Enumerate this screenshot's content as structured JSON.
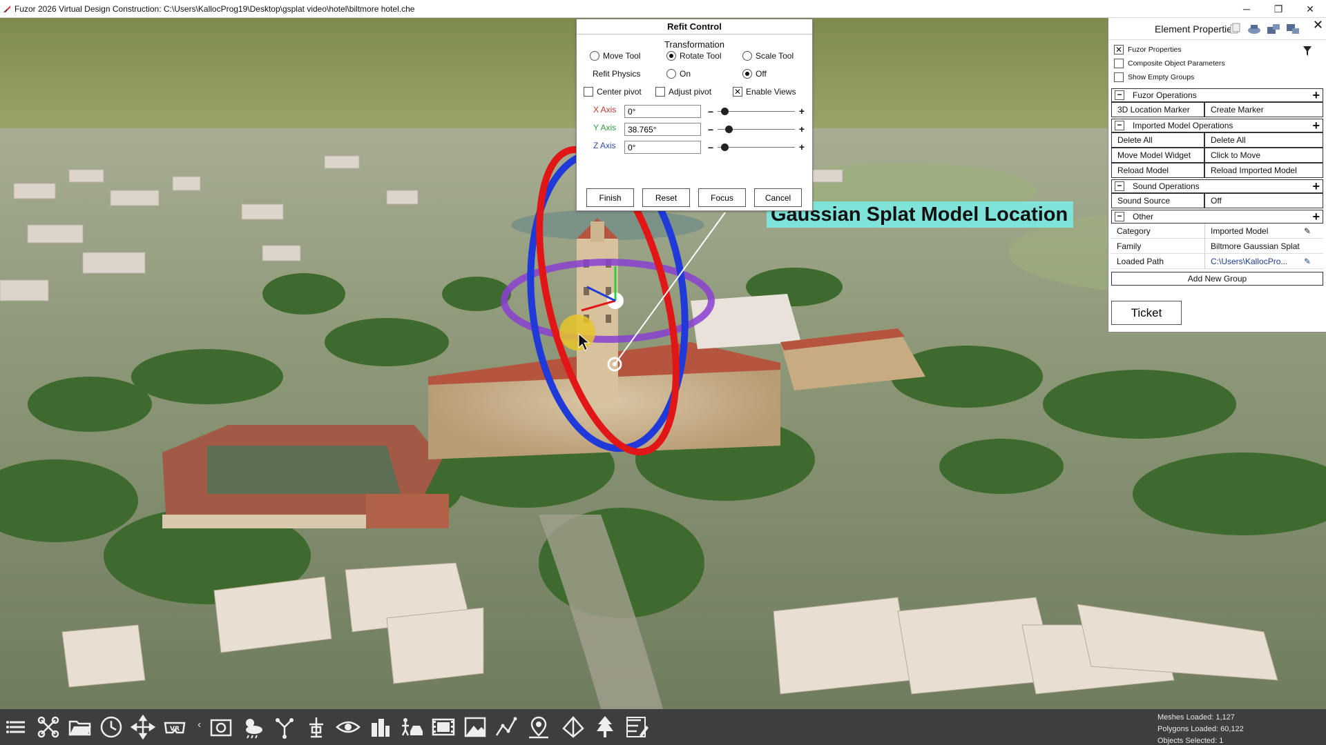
{
  "window": {
    "title": "Fuzor 2026 Virtual Design Construction: C:\\Users\\KallocProg19\\Desktop\\gsplat video\\hotel\\biltmore hotel.che",
    "minimize": "─",
    "restore": "❐",
    "close": "✕"
  },
  "refit": {
    "title": "Refit Control",
    "section": "Transformation",
    "tools": [
      "Move Tool",
      "Rotate Tool",
      "Scale Tool"
    ],
    "selected_tool": "Rotate Tool",
    "physics_label": "Refit Physics",
    "physics_on": "On",
    "physics_off": "Off",
    "physics_value": "Off",
    "center_pivot": "Center pivot",
    "adjust_pivot": "Adjust pivot",
    "enable_views": "Enable Views",
    "center_pivot_checked": false,
    "adjust_pivot_checked": false,
    "enable_views_checked": true,
    "axes": [
      {
        "label": "X Axis",
        "value": "0°",
        "color": "#c0392b",
        "slider": 0.05
      },
      {
        "label": "Y Axis",
        "value": "38.765°",
        "color": "#2e9e3a",
        "slider": 0.11
      },
      {
        "label": "Z Axis",
        "value": "0°",
        "color": "#2b4fa8",
        "slider": 0.05
      }
    ],
    "slider_minus": "−",
    "slider_plus": "+",
    "buttons": [
      "Finish",
      "Reset",
      "Focus",
      "Cancel"
    ]
  },
  "annotation": "Gaussian Splat Model Location",
  "props": {
    "title": "Element Properties",
    "close": "✕",
    "checks": [
      {
        "label": "Fuzor Properties",
        "checked": true
      },
      {
        "label": "Composite Object Parameters",
        "checked": false
      },
      {
        "label": "Show Empty Groups",
        "checked": false
      }
    ],
    "groups": {
      "fuzor_ops": "Fuzor Operations",
      "imported_ops": "Imported Model Operations",
      "sound_ops": "Sound Operations",
      "other": "Other"
    },
    "fuzor_rows": [
      {
        "k": "3D Location Marker",
        "v": "Create Marker"
      }
    ],
    "imported_rows": [
      {
        "k": "Delete All",
        "v": "Delete All"
      },
      {
        "k": "Move Model Widget",
        "v": "Click to Move"
      },
      {
        "k": "Reload Model",
        "v": "Reload Imported Model"
      }
    ],
    "sound_rows": [
      {
        "k": "Sound Source",
        "v": "Off"
      }
    ],
    "other_rows": [
      {
        "k": "Category",
        "v": "Imported Model"
      },
      {
        "k": "Family",
        "v": "Biltmore Gaussian Splat"
      },
      {
        "k": "Loaded Path",
        "v": "C:\\Users\\KallocPro..."
      }
    ],
    "toggle_symbol": "−",
    "plus_symbol": "+",
    "pencil": "✎",
    "add_group": "Add New Group",
    "ticket": "Ticket"
  },
  "toolbar": {
    "tools": [
      "menu-icon",
      "drone-icon",
      "folder-icon",
      "clock-icon",
      "move-arrows-icon",
      "vr-icon",
      "camera-icon",
      "weather-icon",
      "branch-icon",
      "pin-stand-icon",
      "eye-icon",
      "building-icon",
      "person-car-icon",
      "film-icon",
      "image-icon",
      "chart-line-icon",
      "map-pin-icon",
      "network-icon",
      "tree-icon",
      "list-edit-icon"
    ],
    "collapse": "‹"
  },
  "stats": {
    "meshes": "Meshes Loaded: 1,127",
    "polygons": "Polygons Loaded: 60,122",
    "objects": "Objects Selected: 1"
  }
}
